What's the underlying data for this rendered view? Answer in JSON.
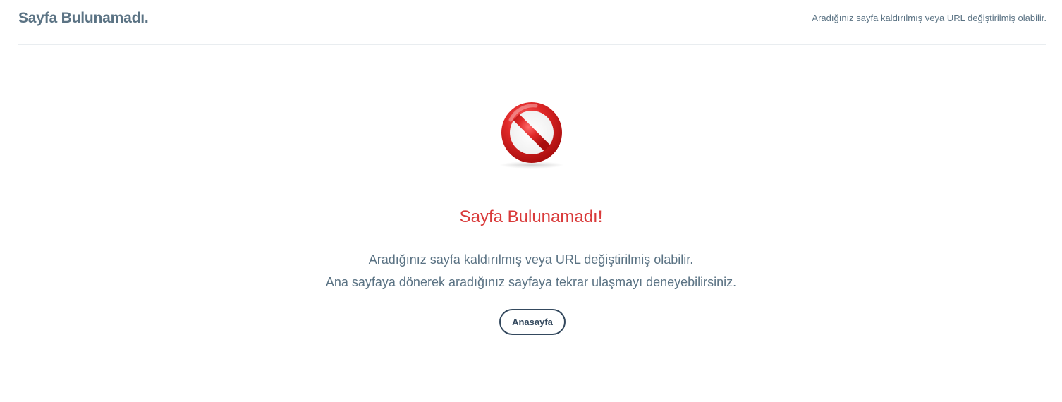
{
  "header": {
    "title": "Sayfa Bulunamadı.",
    "subtitle": "Aradığınız sayfa kaldırılmış veya URL değiştirilmiş olabilir."
  },
  "main": {
    "icon": "no-entry-icon",
    "heading": "Sayfa Bulunamadı!",
    "message_line1": "Aradığınız sayfa kaldırılmış veya URL değiştirilmiş olabilir.",
    "message_line2": "Ana sayfaya dönerek aradığınız sayfaya tekrar ulaşmayı deneyebilirsiniz.",
    "home_button_label": "Anasayfa"
  },
  "colors": {
    "title": "#5b7384",
    "heading_red": "#d93a3a",
    "icon_red": "#d21f1f",
    "button_border": "#34495e"
  }
}
